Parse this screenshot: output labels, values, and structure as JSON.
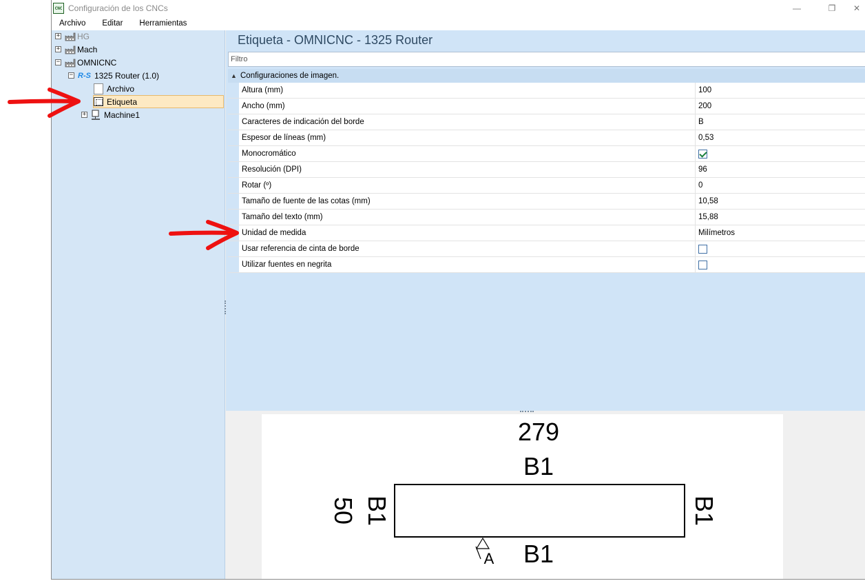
{
  "window": {
    "app_icon_text": "CNC",
    "title": "Configuración de los CNCs",
    "minimize_glyph": "—",
    "restore_glyph": "❐",
    "close_glyph": "✕"
  },
  "menu": {
    "items": [
      "Archivo",
      "Editar",
      "Herramientas"
    ]
  },
  "tree": {
    "nodes": [
      {
        "label": "HG",
        "expander": "+"
      },
      {
        "label": "Mach",
        "expander": "+"
      },
      {
        "label": "OMNICNC",
        "expander": "−"
      },
      {
        "label": "1325 Router (1.0)",
        "expander": "−",
        "icon_text": "R-S"
      },
      {
        "label": "Archivo"
      },
      {
        "label": "Etiqueta",
        "selected": true
      },
      {
        "label": "Machine1",
        "expander": "+"
      }
    ]
  },
  "panel": {
    "title": "Etiqueta - OMNICNC - 1325 Router",
    "filter_placeholder": "Filtro",
    "group_label": "Configuraciones de imagen.",
    "group_caret": "▲"
  },
  "properties": [
    {
      "name": "Altura (mm)",
      "value": "100"
    },
    {
      "name": "Ancho (mm)",
      "value": "200"
    },
    {
      "name": "Caracteres de indicación del borde",
      "value": "B"
    },
    {
      "name": "Espesor de líneas (mm)",
      "value": "0,53"
    },
    {
      "name": "Monocromático",
      "checked": true
    },
    {
      "name": "Resolución (DPI)",
      "value": "96"
    },
    {
      "name": "Rotar (º)",
      "value": "0"
    },
    {
      "name": "Tamaño de fuente de las cotas (mm)",
      "value": "10,58"
    },
    {
      "name": "Tamaño del texto (mm)",
      "value": "15,88"
    },
    {
      "name": "Unidad de medida",
      "value": "Milímetros"
    },
    {
      "name": "Usar referencia de cinta de borde",
      "checked": false
    },
    {
      "name": "Utilizar fuentes en negrita",
      "checked": false
    }
  ],
  "preview": {
    "width_dimension": "279",
    "height_dimension": "50",
    "edge_top": "B1",
    "edge_bottom": "B1",
    "edge_left": "B1",
    "edge_right": "B1",
    "reference_mark": "A"
  },
  "colors": {
    "annotation_arrow": "#ee1111",
    "tree_background": "#d5e6f6",
    "panel_background": "#d0e4f7",
    "selection": "#fde9c3"
  }
}
